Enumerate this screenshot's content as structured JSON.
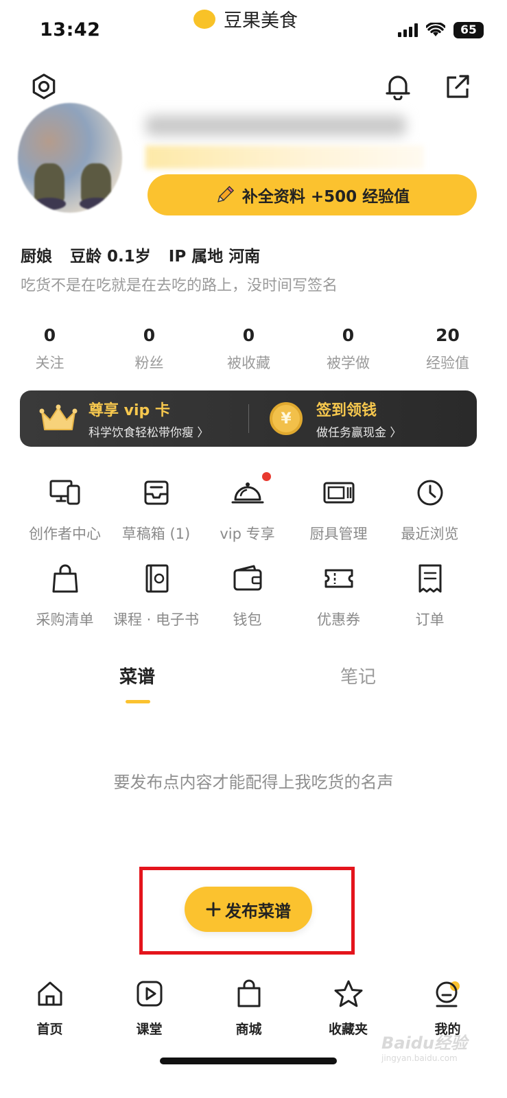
{
  "status_bar": {
    "time": "13:42",
    "app_name": "豆果美食",
    "battery": "65"
  },
  "profile": {
    "complete_button": "补全资料 +500 经验值",
    "role": "厨娘",
    "age": "豆龄 0.1岁",
    "ip": "IP 属地 河南",
    "signature": "吃货不是在吃就是在去吃的路上，没时间写签名"
  },
  "stats": [
    {
      "value": "0",
      "label": "关注"
    },
    {
      "value": "0",
      "label": "粉丝"
    },
    {
      "value": "0",
      "label": "被收藏"
    },
    {
      "value": "0",
      "label": "被学做"
    },
    {
      "value": "20",
      "label": "经验值"
    }
  ],
  "vip_banner": {
    "vip_title": "尊享 vip 卡",
    "vip_subtitle": "科学饮食轻松带你瘦 〉",
    "checkin_title": "签到领钱",
    "checkin_subtitle": "做任务赢现金 〉",
    "coin_symbol": "¥"
  },
  "grid_row1": [
    {
      "label": "创作者中心",
      "icon": "creator-icon"
    },
    {
      "label": "草稿箱 (1)",
      "icon": "drafts-icon"
    },
    {
      "label": "vip 专享",
      "icon": "cloche-icon"
    },
    {
      "label": "厨具管理",
      "icon": "oven-icon"
    },
    {
      "label": "最近浏览",
      "icon": "clock-icon"
    }
  ],
  "grid_row2": [
    {
      "label": "采购清单",
      "icon": "shopping-bag-icon"
    },
    {
      "label": "课程 · 电子书",
      "icon": "ebook-icon"
    },
    {
      "label": "钱包",
      "icon": "wallet-icon"
    },
    {
      "label": "优惠券",
      "icon": "coupon-icon"
    },
    {
      "label": "订单",
      "icon": "receipt-icon"
    }
  ],
  "tabs": {
    "recipes": "菜谱",
    "notes": "笔记"
  },
  "empty_state": "要发布点内容才能配得上我吃货的名声",
  "publish_button": "发布菜谱",
  "bottom_nav": [
    {
      "label": "首页",
      "icon": "home-icon"
    },
    {
      "label": "课堂",
      "icon": "play-icon"
    },
    {
      "label": "商城",
      "icon": "shopping-bag-icon"
    },
    {
      "label": "收藏夹",
      "icon": "star-icon"
    },
    {
      "label": "我的",
      "icon": "profile-icon"
    }
  ],
  "watermark": {
    "brand": "Baidu经验",
    "url": "jingyan.baidu.com"
  },
  "colors": {
    "accent": "#fbc22f",
    "highlight_border": "#e4141c",
    "banner_bg": "#2f2f2f",
    "vip_gold": "#f7c84e"
  }
}
